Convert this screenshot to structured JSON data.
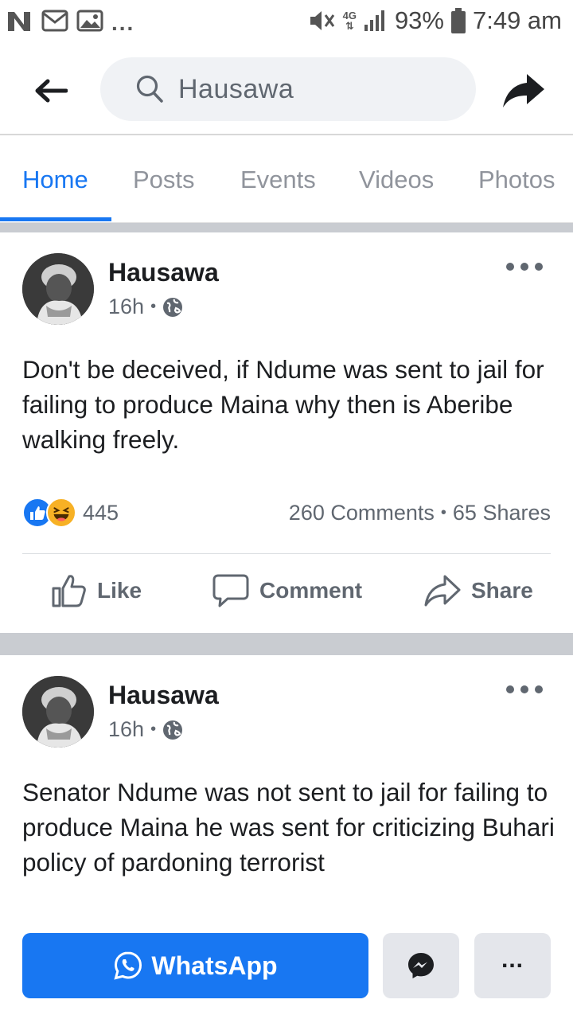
{
  "status_bar": {
    "battery": "93%",
    "time": "7:49 am",
    "network": "4G",
    "icons": [
      "notification-n-icon",
      "email-icon",
      "image-icon",
      "more-dots",
      "mute-icon",
      "signal-icon",
      "battery-icon"
    ],
    "more": "..."
  },
  "header": {
    "search_text": "Hausawa",
    "icons": [
      "back-arrow-icon",
      "search-icon",
      "share-arrow-icon"
    ]
  },
  "tabs": [
    {
      "label": "Home",
      "active": true
    },
    {
      "label": "Posts",
      "active": false
    },
    {
      "label": "Events",
      "active": false
    },
    {
      "label": "Videos",
      "active": false
    },
    {
      "label": "Photos",
      "active": false
    }
  ],
  "posts": [
    {
      "author": "Hausawa",
      "time": "16h",
      "separator": "•",
      "privacy_icon": "globe-icon",
      "text": "Don't be deceived, if Ndume was sent to jail for failing to produce Maina why then is Aberibe walking freely.",
      "reaction_count": "445",
      "comments": "260 Comments",
      "shares": "65 Shares",
      "actions": {
        "like": "Like",
        "comment": "Comment",
        "share": "Share"
      }
    },
    {
      "author": "Hausawa",
      "time": "16h",
      "separator": "•",
      "privacy_icon": "globe-icon",
      "text": "Senator Ndume was not sent to jail for failing to produce Maina he was sent for criticizing Buhari policy of pardoning terrorist"
    }
  ],
  "bottom_bar": {
    "whatsapp_label": "WhatsApp",
    "more_label": "..."
  },
  "colors": {
    "accent": "#1877f2",
    "tab_inactive": "#90949c",
    "separator": "#c9ccd1",
    "reaction_like": "#1877f2",
    "reaction_haha": "#f7b125"
  }
}
